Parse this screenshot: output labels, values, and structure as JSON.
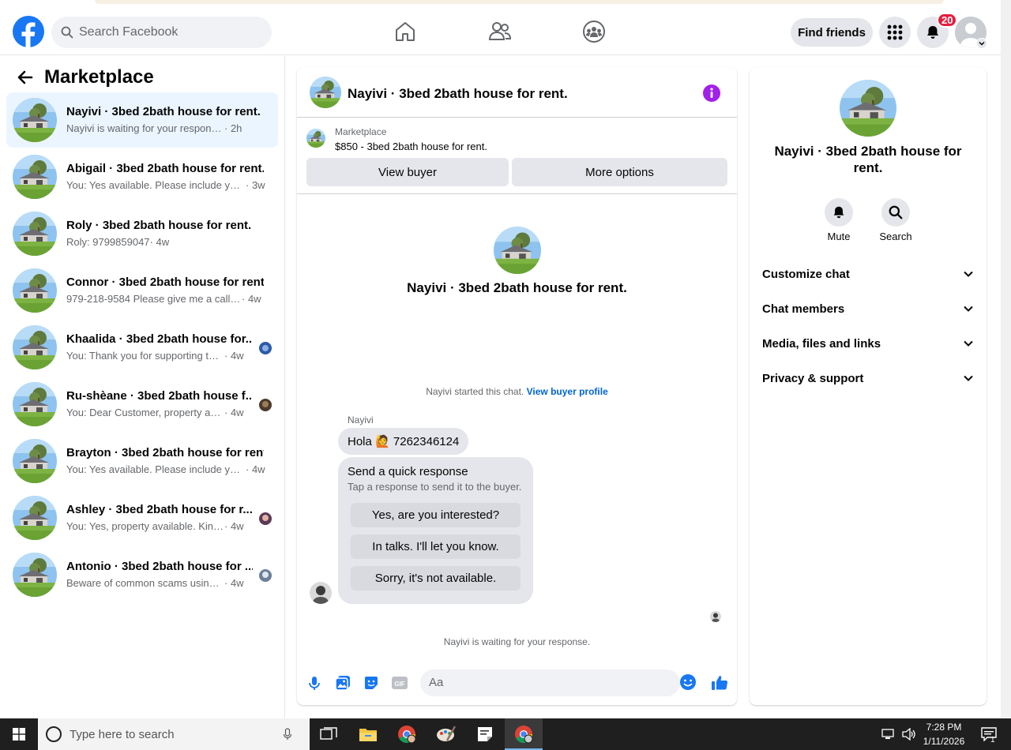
{
  "header": {
    "search_placeholder": "Search Facebook",
    "find_friends": "Find friends",
    "notification_count": "20"
  },
  "sidebar": {
    "title": "Marketplace",
    "conversations": [
      {
        "title": "Nayivi · 3bed 2bath house for rent.",
        "message": "Nayivi is waiting for your response.",
        "time": " · 2h",
        "active": true
      },
      {
        "title": "Abigail · 3bed 2bath house for rent.",
        "message": "You: Yes available. Please include your...",
        "time": " · 3w"
      },
      {
        "title": "Roly · 3bed 2bath house for rent.",
        "message": "Roly: 9799859047",
        "time": " · 4w"
      },
      {
        "title": "Connor · 3bed 2bath house for rent.",
        "message": "979-218-9584 Please give me a call t...",
        "time": " · 4w"
      },
      {
        "title": "Khaalida · 3bed 2bath house for...",
        "message": "You: Thank you for supporting the ...",
        "time": " · 4w"
      },
      {
        "title": "Ru-shèane · 3bed 2bath house f...",
        "message": "You: Dear Customer, property avail...",
        "time": " · 4w"
      },
      {
        "title": "Brayton · 3bed 2bath house for rent.",
        "message": "You: Yes available. Please include your...",
        "time": " · 4w"
      },
      {
        "title": "Ashley · 3bed 2bath house for r...",
        "message": "You: Yes, property available. Kindly ...",
        "time": " · 4w"
      },
      {
        "title": "Antonio · 3bed 2bath house for ...",
        "message": "Beware of common scams using p...",
        "time": " · 4w"
      }
    ]
  },
  "chat": {
    "title": "Nayivi · 3bed 2bath house for rent.",
    "marketplace_label": "Marketplace",
    "listing": "$850 - 3bed 2bath house for rent.",
    "view_buyer": "View buyer",
    "more_options": "More options",
    "profile_title": "Nayivi · 3bed 2bath house for rent.",
    "started_text": "Nayivi started this chat.",
    "view_buyer_profile": "View buyer profile",
    "sender_name": "Nayivi",
    "message_prefix": "Hola",
    "message_emoji": "🙋",
    "message_suffix": "7262346124",
    "quick_title": "Send a quick response",
    "quick_subtitle": "Tap a response to send it to the buyer.",
    "quick_replies": [
      "Yes, are you interested?",
      "In talks. I'll let you know.",
      "Sorry, it's not available."
    ],
    "waiting_text": "Nayivi is waiting for your response.",
    "composer_placeholder": "Aa"
  },
  "details": {
    "title": "Nayivi · 3bed 2bath house for rent.",
    "mute": "Mute",
    "search": "Search",
    "sections": [
      "Customize chat",
      "Chat members",
      "Media, files and links",
      "Privacy & support"
    ]
  },
  "taskbar": {
    "search_placeholder": "Type here to search",
    "time": "7:28 PM",
    "date": "1/11/2026",
    "notification_count": "1"
  },
  "colors": {
    "brand": "#1877f2",
    "active_row": "#ebf5ff",
    "badge": "#e41e3f",
    "info_purple": "#a121e8"
  }
}
